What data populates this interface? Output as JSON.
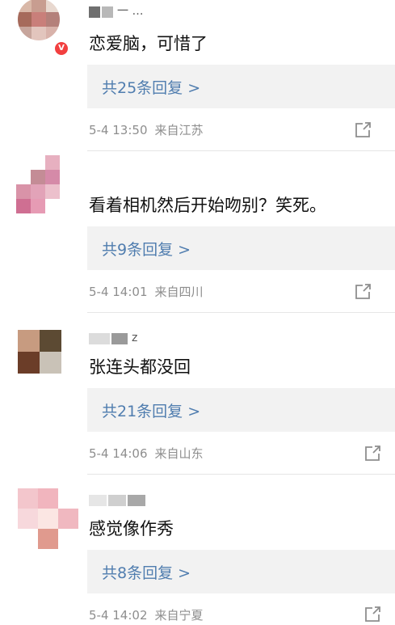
{
  "comments": [
    {
      "user": "一 …",
      "content": "恋爱脑，可惜了",
      "replies": "共25条回复 >",
      "time": "5-4 13:50",
      "location": "来自江苏",
      "verified_badge": "V"
    },
    {
      "user": "",
      "content": "看着相机然后开始吻别？笑死。",
      "replies": "共9条回复 >",
      "time": "5-4 14:01",
      "location": "来自四川"
    },
    {
      "user": "z",
      "content": "张连头都没回",
      "replies": "共21条回复 >",
      "time": "5-4 14:06",
      "location": "来自山东"
    },
    {
      "user": "",
      "content": "感觉像作秀",
      "replies": "共8条回复 >",
      "time": "5-4 14:02",
      "location": "来自宁夏"
    }
  ],
  "colors": {
    "link": "#507daf",
    "meta": "#8e8e8e",
    "reply_bg": "#f2f2f2",
    "badge": "#f23f3f"
  },
  "icons": {
    "share": "share-external-icon"
  }
}
